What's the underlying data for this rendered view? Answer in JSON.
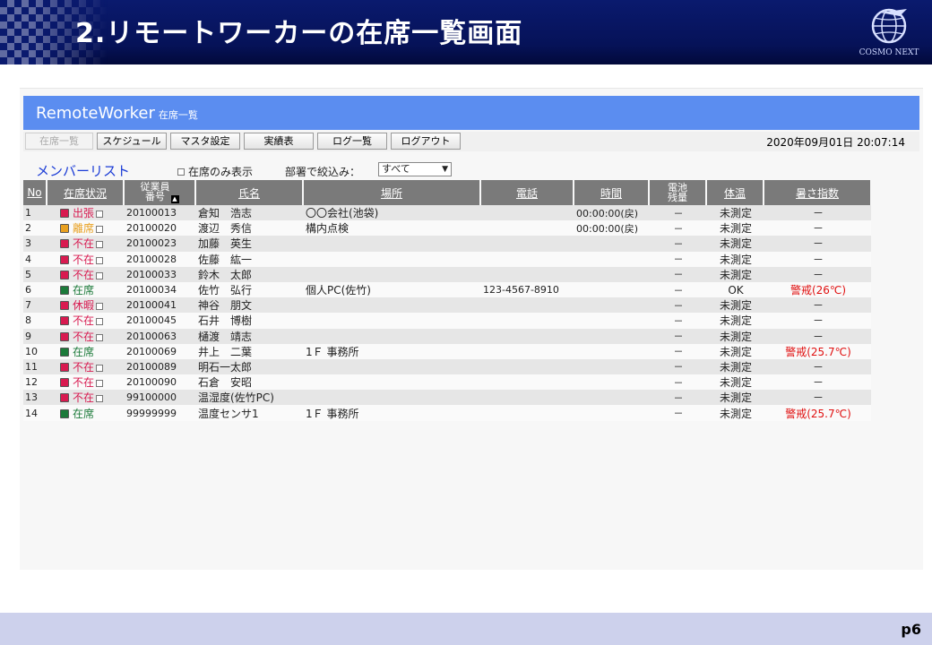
{
  "slide": {
    "title": "2.リモートワーカーの在席一覧画面",
    "brand": "COSMO NEXT",
    "page": "p6"
  },
  "app": {
    "name": "RemoteWorker",
    "subtitle": "在席一覧",
    "header_color": "#5b8df0",
    "datetime": "2020年09月01日 20:07:14"
  },
  "toolbar": [
    {
      "label": "在席一覧",
      "disabled": true
    },
    {
      "label": "スケジュール",
      "disabled": false
    },
    {
      "label": "マスタ設定",
      "disabled": false
    },
    {
      "label": "実績表",
      "disabled": false
    },
    {
      "label": "ログ一覧",
      "disabled": false
    },
    {
      "label": "ログアウト",
      "disabled": false
    }
  ],
  "list": {
    "title": "メンバーリスト",
    "only_present_label": "在席のみ表示",
    "filter_label": "部署で絞込み：",
    "filter_value": "すべて"
  },
  "columns": {
    "no": "No",
    "status": "在席状況",
    "emp_no_1": "従業員",
    "emp_no_2": "番号",
    "name": "氏名",
    "location": "場所",
    "phone": "電話",
    "time": "時間",
    "battery_1": "電池",
    "battery_2": "残量",
    "temp": "体温",
    "heat": "暑さ指数"
  },
  "status_colors": {
    "出張": "#d81a50",
    "離席": "#e8a020",
    "不在": "#d81a50",
    "在席": "#1c7a3a",
    "休暇": "#d81a50"
  },
  "rows": [
    {
      "no": "1",
      "status": "出張",
      "checkbox": true,
      "emp": "20100013",
      "name": "倉知　浩志",
      "location": "〇〇会社(池袋)",
      "phone": "",
      "time": "00:00:00(戻)",
      "battery": "－",
      "temp": "未測定",
      "heat": "－",
      "heat_warn": false
    },
    {
      "no": "2",
      "status": "離席",
      "checkbox": true,
      "emp": "20100020",
      "name": "渡辺　秀信",
      "location": "構内点検",
      "phone": "",
      "time": "00:00:00(戻)",
      "battery": "－",
      "temp": "未測定",
      "heat": "－",
      "heat_warn": false
    },
    {
      "no": "3",
      "status": "不在",
      "checkbox": true,
      "emp": "20100023",
      "name": "加藤　英生",
      "location": "",
      "phone": "",
      "time": "",
      "battery": "－",
      "temp": "未測定",
      "heat": "－",
      "heat_warn": false
    },
    {
      "no": "4",
      "status": "不在",
      "checkbox": true,
      "emp": "20100028",
      "name": "佐藤　紘一",
      "location": "",
      "phone": "",
      "time": "",
      "battery": "－",
      "temp": "未測定",
      "heat": "－",
      "heat_warn": false
    },
    {
      "no": "5",
      "status": "不在",
      "checkbox": true,
      "emp": "20100033",
      "name": "鈴木　太郎",
      "location": "",
      "phone": "",
      "time": "",
      "battery": "－",
      "temp": "未測定",
      "heat": "－",
      "heat_warn": false
    },
    {
      "no": "6",
      "status": "在席",
      "checkbox": false,
      "emp": "20100034",
      "name": "佐竹　弘行",
      "location": "個人PC(佐竹)",
      "phone": "123-4567-8910",
      "time": "",
      "battery": "－",
      "temp": "OK",
      "heat": "警戒(26℃)",
      "heat_warn": true
    },
    {
      "no": "7",
      "status": "休暇",
      "checkbox": true,
      "emp": "20100041",
      "name": "神谷　朋文",
      "location": "",
      "phone": "",
      "time": "",
      "battery": "－",
      "temp": "未測定",
      "heat": "－",
      "heat_warn": false
    },
    {
      "no": "8",
      "status": "不在",
      "checkbox": true,
      "emp": "20100045",
      "name": "石井　博樹",
      "location": "",
      "phone": "",
      "time": "",
      "battery": "－",
      "temp": "未測定",
      "heat": "－",
      "heat_warn": false
    },
    {
      "no": "9",
      "status": "不在",
      "checkbox": true,
      "emp": "20100063",
      "name": "樋渡　靖志",
      "location": "",
      "phone": "",
      "time": "",
      "battery": "－",
      "temp": "未測定",
      "heat": "－",
      "heat_warn": false
    },
    {
      "no": "10",
      "status": "在席",
      "checkbox": false,
      "emp": "20100069",
      "name": "井上　二葉",
      "location": "1Ｆ 事務所",
      "phone": "",
      "time": "",
      "battery": "－",
      "temp": "未測定",
      "heat": "警戒(25.7℃)",
      "heat_warn": true
    },
    {
      "no": "11",
      "status": "不在",
      "checkbox": true,
      "emp": "20100089",
      "name": "明石一太郎",
      "location": "",
      "phone": "",
      "time": "",
      "battery": "－",
      "temp": "未測定",
      "heat": "－",
      "heat_warn": false
    },
    {
      "no": "12",
      "status": "不在",
      "checkbox": true,
      "emp": "20100090",
      "name": "石倉　安昭",
      "location": "",
      "phone": "",
      "time": "",
      "battery": "－",
      "temp": "未測定",
      "heat": "－",
      "heat_warn": false
    },
    {
      "no": "13",
      "status": "不在",
      "checkbox": true,
      "emp": "99100000",
      "name": "温湿度(佐竹PC)",
      "location": "",
      "phone": "",
      "time": "",
      "battery": "－",
      "temp": "未測定",
      "heat": "－",
      "heat_warn": false
    },
    {
      "no": "14",
      "status": "在席",
      "checkbox": false,
      "emp": "99999999",
      "name": "温度センサ1",
      "location": "1Ｆ 事務所",
      "phone": "",
      "time": "",
      "battery": "－",
      "temp": "未測定",
      "heat": "警戒(25.7℃)",
      "heat_warn": true
    }
  ]
}
